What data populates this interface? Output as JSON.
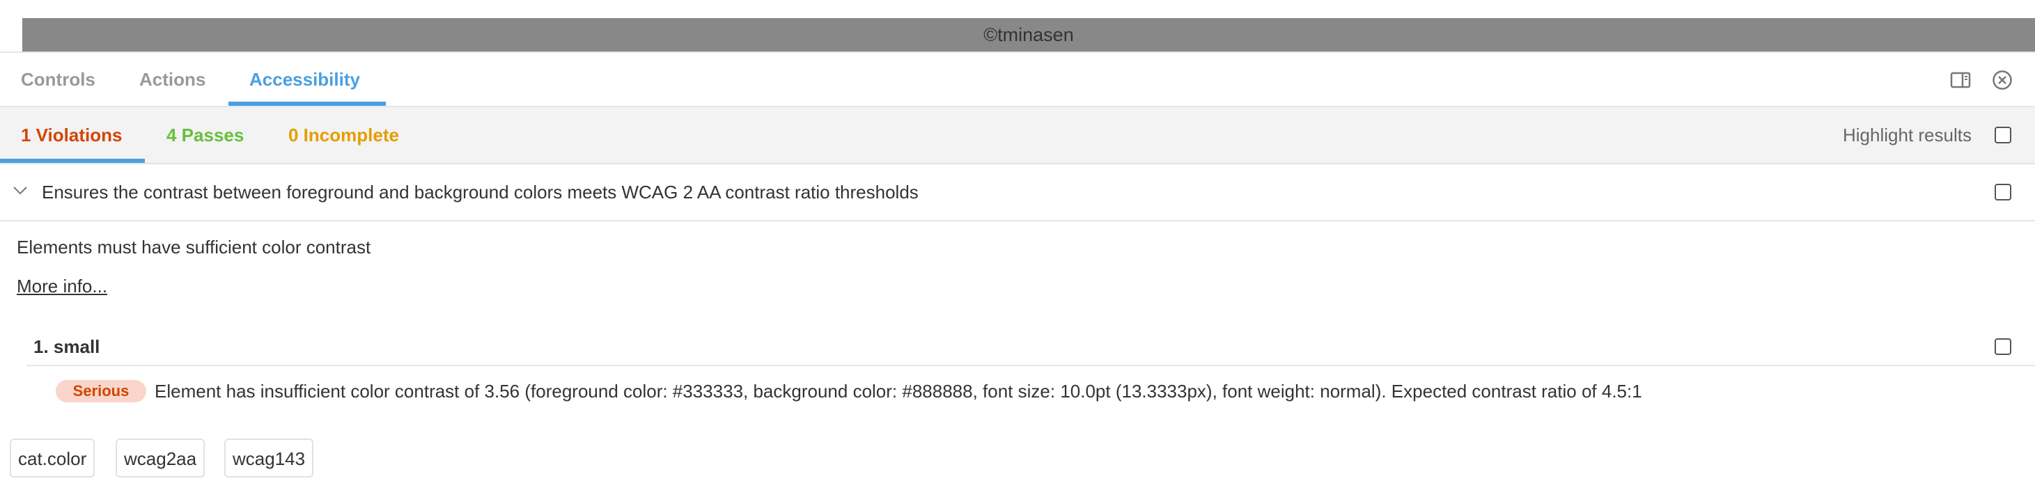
{
  "preview": {
    "watermark": "©tminasen"
  },
  "tabs": [
    {
      "label": "Controls",
      "active": false
    },
    {
      "label": "Actions",
      "active": false
    },
    {
      "label": "Accessibility",
      "active": true
    }
  ],
  "toolbar_icons": [
    "panel-orientation-icon",
    "close-icon"
  ],
  "subtabs": {
    "violations": {
      "label": "1 Violations",
      "color": "#d24500"
    },
    "passes": {
      "label": "4 Passes",
      "color": "#66bf3c"
    },
    "incomplete": {
      "label": "0 Incomplete",
      "color": "#e69d00"
    },
    "highlight_label": "Highlight results",
    "highlight_checked": false
  },
  "rule": {
    "expanded": true,
    "title": "Ensures the contrast between foreground and background colors meets WCAG 2 AA contrast ratio thresholds",
    "description": "Elements must have sufficient color contrast",
    "more_info": "More info...",
    "nodes": [
      {
        "label": "1. small",
        "impact": "Serious",
        "message": "Element has insufficient color contrast of 3.56 (foreground color: #333333, background color: #888888, font size: 10.0pt (13.3333px), font weight: normal). Expected contrast ratio of 4.5:1"
      }
    ],
    "tags": [
      "cat.color",
      "wcag2aa",
      "wcag143"
    ]
  },
  "colors": {
    "accent": "#4a9fe0",
    "serious_bg": "#f9d6c9",
    "serious_text": "#d24500",
    "preview_bg": "#888888"
  }
}
